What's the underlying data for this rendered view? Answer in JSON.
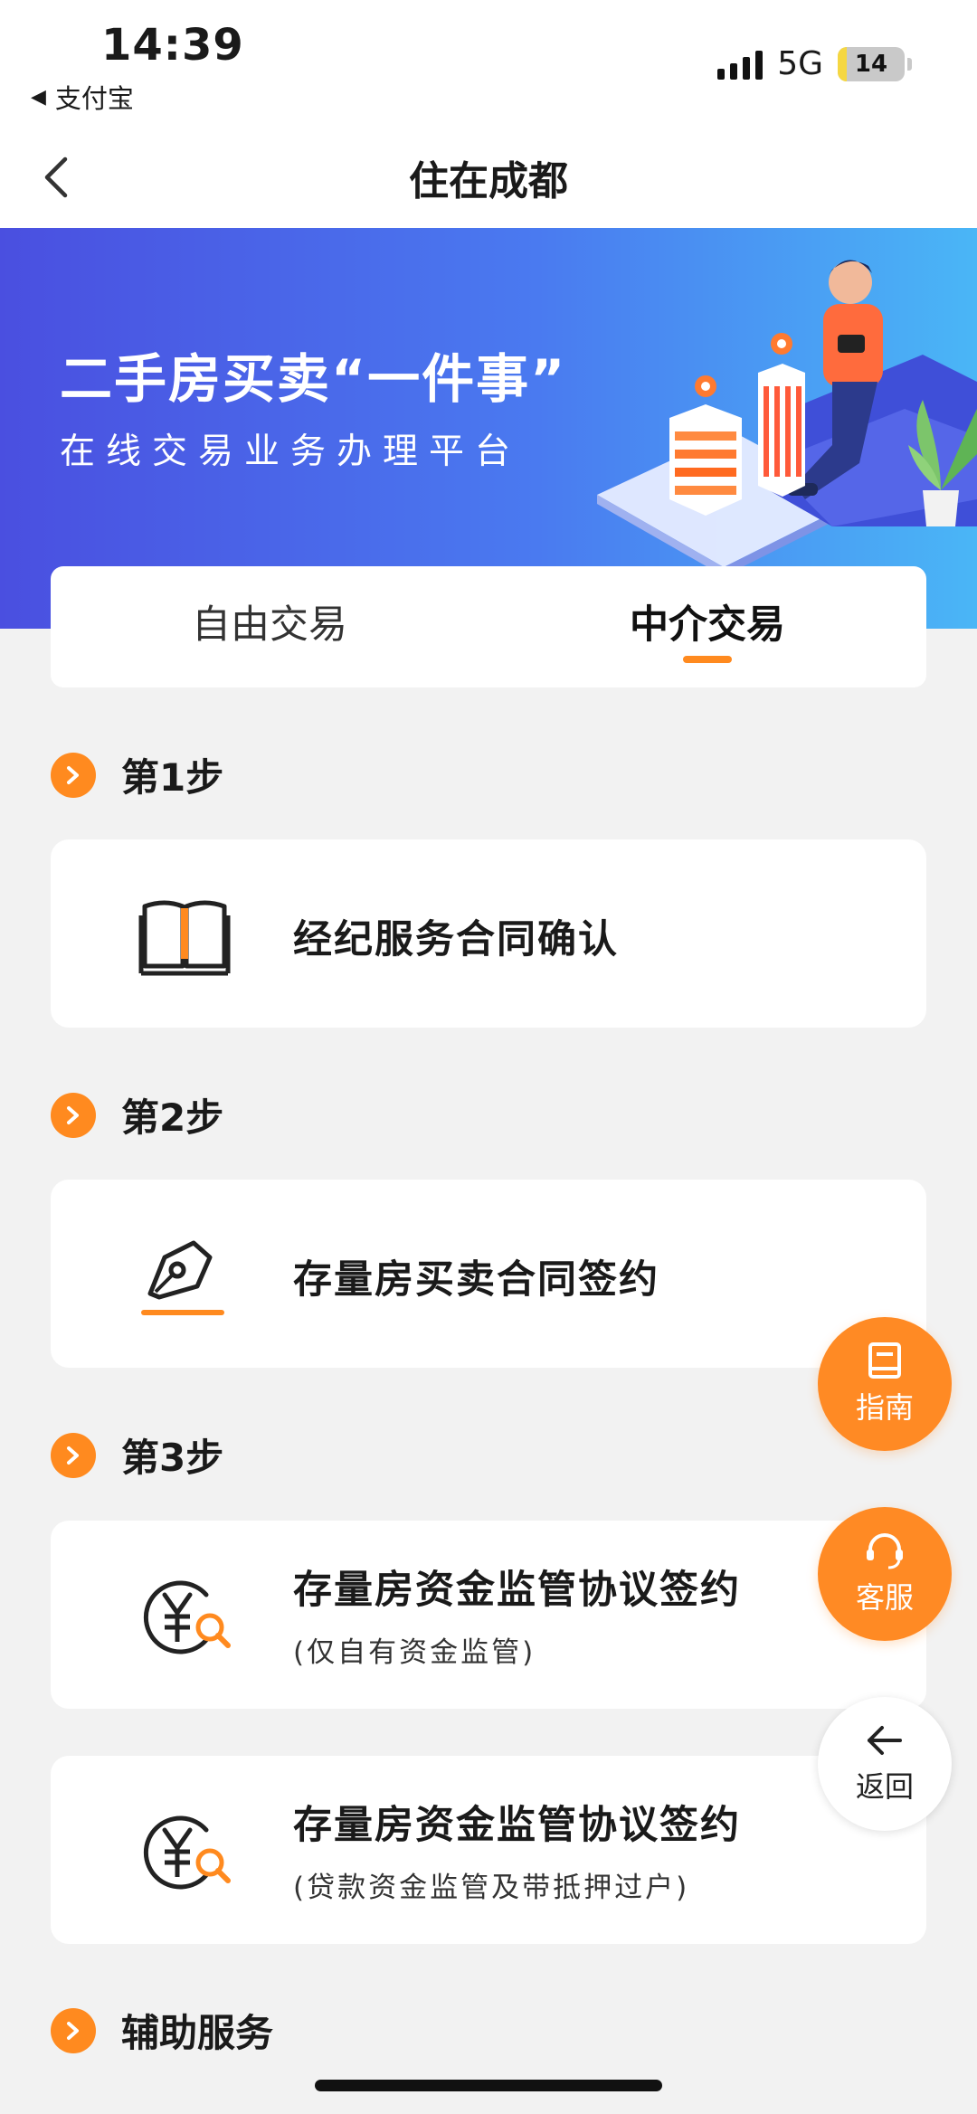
{
  "status_bar": {
    "time": "14:39",
    "back_app": "支付宝",
    "network": "5G",
    "battery": "14",
    "battery_level_percent": 14
  },
  "nav": {
    "title": "住在成都"
  },
  "banner": {
    "title": "二手房买卖“一件事”",
    "subtitle": "在线交易业务办理平台"
  },
  "tabs": [
    {
      "label": "自由交易",
      "active": false
    },
    {
      "label": "中介交易",
      "active": true
    }
  ],
  "steps": [
    {
      "label": "第1步"
    },
    {
      "label": "第2步"
    },
    {
      "label": "第3步"
    },
    {
      "label": "辅助服务"
    }
  ],
  "cards": [
    {
      "title": "经纪服务合同确认",
      "icon": "book-icon"
    },
    {
      "title": "存量房买卖合同签约",
      "icon": "pen-sign-icon"
    },
    {
      "title": "存量房资金监管协议签约",
      "subtitle": "(仅自有资金监管)",
      "icon": "yuan-search-icon"
    },
    {
      "title": "存量房资金监管协议签约",
      "subtitle": "(贷款资金监管及带抵押过户)",
      "icon": "yuan-search-icon"
    }
  ],
  "fabs": {
    "guide": "指南",
    "service": "客服",
    "back": "返回"
  },
  "colors": {
    "accent": "#ff8a1f",
    "banner_start": "#4a4fe0",
    "banner_end": "#4ab6f6",
    "background": "#f2f2f2"
  }
}
